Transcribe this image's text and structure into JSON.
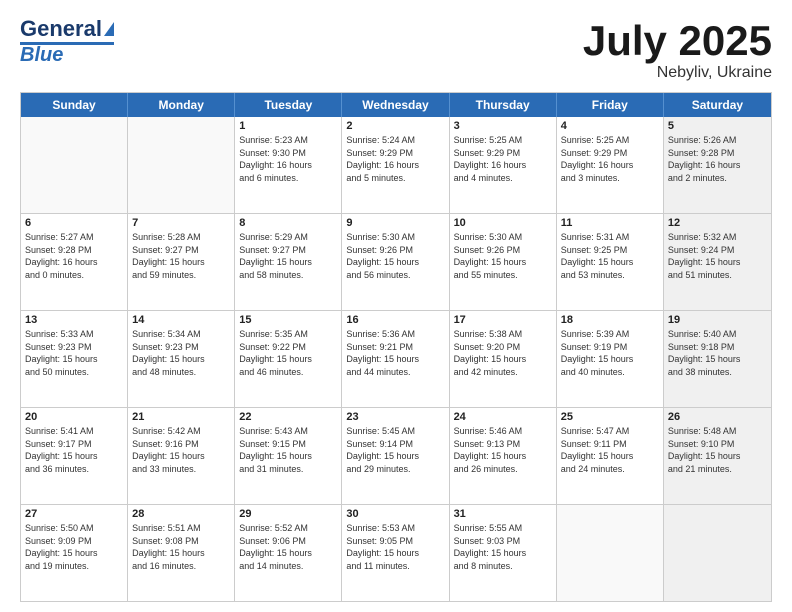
{
  "header": {
    "logo_general": "General",
    "logo_blue": "Blue",
    "title": "July 2025",
    "location": "Nebyliv, Ukraine"
  },
  "days": [
    "Sunday",
    "Monday",
    "Tuesday",
    "Wednesday",
    "Thursday",
    "Friday",
    "Saturday"
  ],
  "rows": [
    [
      {
        "day": "",
        "text": "",
        "empty": true
      },
      {
        "day": "",
        "text": "",
        "empty": true
      },
      {
        "day": "1",
        "text": "Sunrise: 5:23 AM\nSunset: 9:30 PM\nDaylight: 16 hours\nand 6 minutes."
      },
      {
        "day": "2",
        "text": "Sunrise: 5:24 AM\nSunset: 9:29 PM\nDaylight: 16 hours\nand 5 minutes."
      },
      {
        "day": "3",
        "text": "Sunrise: 5:25 AM\nSunset: 9:29 PM\nDaylight: 16 hours\nand 4 minutes."
      },
      {
        "day": "4",
        "text": "Sunrise: 5:25 AM\nSunset: 9:29 PM\nDaylight: 16 hours\nand 3 minutes."
      },
      {
        "day": "5",
        "text": "Sunrise: 5:26 AM\nSunset: 9:28 PM\nDaylight: 16 hours\nand 2 minutes.",
        "shaded": true
      }
    ],
    [
      {
        "day": "6",
        "text": "Sunrise: 5:27 AM\nSunset: 9:28 PM\nDaylight: 16 hours\nand 0 minutes."
      },
      {
        "day": "7",
        "text": "Sunrise: 5:28 AM\nSunset: 9:27 PM\nDaylight: 15 hours\nand 59 minutes."
      },
      {
        "day": "8",
        "text": "Sunrise: 5:29 AM\nSunset: 9:27 PM\nDaylight: 15 hours\nand 58 minutes."
      },
      {
        "day": "9",
        "text": "Sunrise: 5:30 AM\nSunset: 9:26 PM\nDaylight: 15 hours\nand 56 minutes."
      },
      {
        "day": "10",
        "text": "Sunrise: 5:30 AM\nSunset: 9:26 PM\nDaylight: 15 hours\nand 55 minutes."
      },
      {
        "day": "11",
        "text": "Sunrise: 5:31 AM\nSunset: 9:25 PM\nDaylight: 15 hours\nand 53 minutes."
      },
      {
        "day": "12",
        "text": "Sunrise: 5:32 AM\nSunset: 9:24 PM\nDaylight: 15 hours\nand 51 minutes.",
        "shaded": true
      }
    ],
    [
      {
        "day": "13",
        "text": "Sunrise: 5:33 AM\nSunset: 9:23 PM\nDaylight: 15 hours\nand 50 minutes."
      },
      {
        "day": "14",
        "text": "Sunrise: 5:34 AM\nSunset: 9:23 PM\nDaylight: 15 hours\nand 48 minutes."
      },
      {
        "day": "15",
        "text": "Sunrise: 5:35 AM\nSunset: 9:22 PM\nDaylight: 15 hours\nand 46 minutes."
      },
      {
        "day": "16",
        "text": "Sunrise: 5:36 AM\nSunset: 9:21 PM\nDaylight: 15 hours\nand 44 minutes."
      },
      {
        "day": "17",
        "text": "Sunrise: 5:38 AM\nSunset: 9:20 PM\nDaylight: 15 hours\nand 42 minutes."
      },
      {
        "day": "18",
        "text": "Sunrise: 5:39 AM\nSunset: 9:19 PM\nDaylight: 15 hours\nand 40 minutes."
      },
      {
        "day": "19",
        "text": "Sunrise: 5:40 AM\nSunset: 9:18 PM\nDaylight: 15 hours\nand 38 minutes.",
        "shaded": true
      }
    ],
    [
      {
        "day": "20",
        "text": "Sunrise: 5:41 AM\nSunset: 9:17 PM\nDaylight: 15 hours\nand 36 minutes."
      },
      {
        "day": "21",
        "text": "Sunrise: 5:42 AM\nSunset: 9:16 PM\nDaylight: 15 hours\nand 33 minutes."
      },
      {
        "day": "22",
        "text": "Sunrise: 5:43 AM\nSunset: 9:15 PM\nDaylight: 15 hours\nand 31 minutes."
      },
      {
        "day": "23",
        "text": "Sunrise: 5:45 AM\nSunset: 9:14 PM\nDaylight: 15 hours\nand 29 minutes."
      },
      {
        "day": "24",
        "text": "Sunrise: 5:46 AM\nSunset: 9:13 PM\nDaylight: 15 hours\nand 26 minutes."
      },
      {
        "day": "25",
        "text": "Sunrise: 5:47 AM\nSunset: 9:11 PM\nDaylight: 15 hours\nand 24 minutes."
      },
      {
        "day": "26",
        "text": "Sunrise: 5:48 AM\nSunset: 9:10 PM\nDaylight: 15 hours\nand 21 minutes.",
        "shaded": true
      }
    ],
    [
      {
        "day": "27",
        "text": "Sunrise: 5:50 AM\nSunset: 9:09 PM\nDaylight: 15 hours\nand 19 minutes."
      },
      {
        "day": "28",
        "text": "Sunrise: 5:51 AM\nSunset: 9:08 PM\nDaylight: 15 hours\nand 16 minutes."
      },
      {
        "day": "29",
        "text": "Sunrise: 5:52 AM\nSunset: 9:06 PM\nDaylight: 15 hours\nand 14 minutes."
      },
      {
        "day": "30",
        "text": "Sunrise: 5:53 AM\nSunset: 9:05 PM\nDaylight: 15 hours\nand 11 minutes."
      },
      {
        "day": "31",
        "text": "Sunrise: 5:55 AM\nSunset: 9:03 PM\nDaylight: 15 hours\nand 8 minutes."
      },
      {
        "day": "",
        "text": "",
        "empty": true
      },
      {
        "day": "",
        "text": "",
        "empty": true,
        "shaded": true
      }
    ]
  ]
}
